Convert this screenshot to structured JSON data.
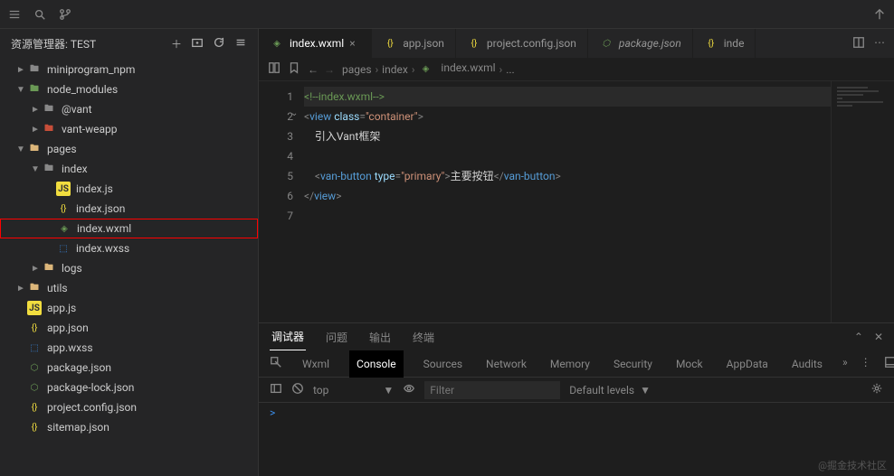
{
  "sidebar": {
    "title": "资源管理器: TEST",
    "tree": [
      {
        "label": "miniprogram_npm",
        "indent": 1,
        "chev": "►",
        "icon": "folder"
      },
      {
        "label": "node_modules",
        "indent": 1,
        "chev": "▼",
        "icon": "folder-green"
      },
      {
        "label": "@vant",
        "indent": 2,
        "chev": "►",
        "icon": "folder"
      },
      {
        "label": "vant-weapp",
        "indent": 2,
        "chev": "►",
        "icon": "folder-red"
      },
      {
        "label": "pages",
        "indent": 1,
        "chev": "▼",
        "icon": "folder-open"
      },
      {
        "label": "index",
        "indent": 2,
        "chev": "▼",
        "icon": "folder"
      },
      {
        "label": "index.js",
        "indent": 3,
        "chev": "",
        "icon": "js"
      },
      {
        "label": "index.json",
        "indent": 3,
        "chev": "",
        "icon": "json"
      },
      {
        "label": "index.wxml",
        "indent": 3,
        "chev": "",
        "icon": "wxml",
        "highlight": true
      },
      {
        "label": "index.wxss",
        "indent": 3,
        "chev": "",
        "icon": "wxss"
      },
      {
        "label": "logs",
        "indent": 2,
        "chev": "►",
        "icon": "folder-open"
      },
      {
        "label": "utils",
        "indent": 1,
        "chev": "►",
        "icon": "folder-open"
      },
      {
        "label": "app.js",
        "indent": 1,
        "chev": "",
        "icon": "js"
      },
      {
        "label": "app.json",
        "indent": 1,
        "chev": "",
        "icon": "json"
      },
      {
        "label": "app.wxss",
        "indent": 1,
        "chev": "",
        "icon": "wxss"
      },
      {
        "label": "package.json",
        "indent": 1,
        "chev": "",
        "icon": "pkg"
      },
      {
        "label": "package-lock.json",
        "indent": 1,
        "chev": "",
        "icon": "pkg"
      },
      {
        "label": "project.config.json",
        "indent": 1,
        "chev": "",
        "icon": "json"
      },
      {
        "label": "sitemap.json",
        "indent": 1,
        "chev": "",
        "icon": "json"
      }
    ]
  },
  "tabs": [
    {
      "label": "index.wxml",
      "icon": "wxml",
      "active": true,
      "close": "×"
    },
    {
      "label": "app.json",
      "icon": "json"
    },
    {
      "label": "project.config.json",
      "icon": "json"
    },
    {
      "label": "package.json",
      "icon": "pkg",
      "italic": true
    },
    {
      "label": "inde",
      "icon": "json"
    }
  ],
  "breadcrumb": {
    "parts": [
      "pages",
      "index",
      "index.wxml",
      "..."
    ]
  },
  "code": {
    "lines": [
      "1",
      "2",
      "3",
      "4",
      "5",
      "6",
      "7"
    ],
    "l1": "<!--index.wxml-->",
    "l2_open": "<",
    "l2_tag": "view",
    "l2_sp": " ",
    "l2_attr": "class",
    "l2_eq": "=",
    "l2_val": "\"container\"",
    "l2_close": ">",
    "l3": "    引入Vant框架",
    "l5_open": "    <",
    "l5_tag": "van-button",
    "l5_sp": " ",
    "l5_attr": "type",
    "l5_eq": "=",
    "l5_val": "\"primary\"",
    "l5_gt": ">",
    "l5_text": "主要按钮",
    "l5_ct": "</",
    "l5_ctag": "van-button",
    "l5_cgt": ">",
    "l6_open": "</",
    "l6_tag": "view",
    "l6_close": ">"
  },
  "panel": {
    "tabs": [
      "调试器",
      "问题",
      "输出",
      "终端"
    ],
    "devtools": [
      "Wxml",
      "Console",
      "Sources",
      "Network",
      "Memory",
      "Security",
      "Mock",
      "AppData",
      "Audits"
    ],
    "context": "top",
    "filter_placeholder": "Filter",
    "levels": "Default levels",
    "prompt": ">"
  },
  "watermark": "@掘金技术社区"
}
